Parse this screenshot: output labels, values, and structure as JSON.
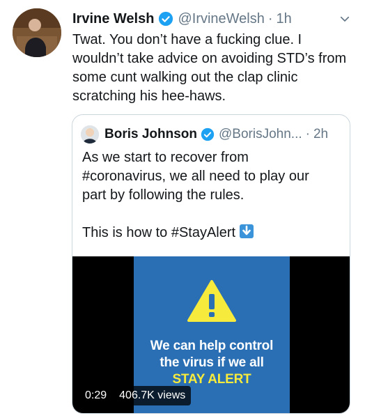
{
  "tweet": {
    "name": "Irvine Welsh",
    "handle": "@IrvineWelsh",
    "separator": "·",
    "time": "1h",
    "lines": [
      "Twat. You don’t have a fucking clue. I",
      "wouldn’t take advice on avoiding STD’s from",
      "some cunt walking out the clap clinic",
      "scratching his hee-haws."
    ],
    "icons": {
      "verified": "verified-badge-icon",
      "caret": "chevron-down-icon"
    }
  },
  "quoted": {
    "name": "Boris Johnson",
    "handle": "@BorisJohn...",
    "separator": "·",
    "time": "2h",
    "lines": [
      "As we start to recover from",
      "#coronavirus, we all need to play our",
      "part by following the rules."
    ],
    "line_last": "This is how to #StayAlert",
    "icons": {
      "arrow": "down-arrow-emoji-icon"
    },
    "video": {
      "line1": "We can help control",
      "line2": "the virus if we all",
      "line3": "STAY ALERT",
      "duration": "0:29",
      "views": "406.7K views"
    }
  },
  "colors": {
    "accent": "#1da1f2",
    "muted": "#657786",
    "card_blue": "#2a6fb3",
    "alert_yellow": "#f6eb3c"
  }
}
